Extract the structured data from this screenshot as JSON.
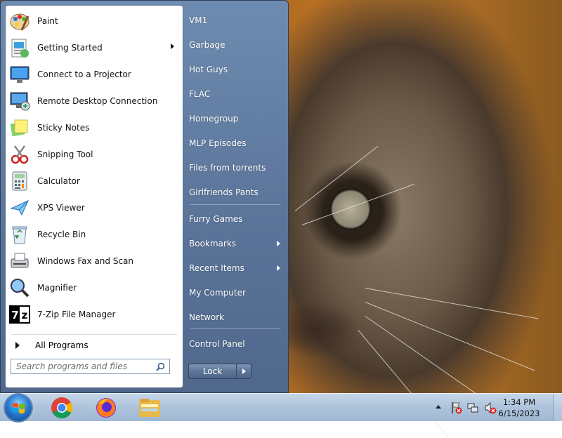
{
  "left_programs": [
    {
      "label": "Paint",
      "icon": "paint-icon",
      "submenu": false
    },
    {
      "label": "Getting Started",
      "icon": "getting-started-icon",
      "submenu": true
    },
    {
      "label": "Connect to a Projector",
      "icon": "projector-icon",
      "submenu": false
    },
    {
      "label": "Remote Desktop Connection",
      "icon": "remote-desktop-icon",
      "submenu": false
    },
    {
      "label": "Sticky Notes",
      "icon": "sticky-notes-icon",
      "submenu": false
    },
    {
      "label": "Snipping Tool",
      "icon": "snipping-tool-icon",
      "submenu": false
    },
    {
      "label": "Calculator",
      "icon": "calculator-icon",
      "submenu": false
    },
    {
      "label": "XPS Viewer",
      "icon": "xps-viewer-icon",
      "submenu": false
    },
    {
      "label": "Recycle Bin",
      "icon": "recycle-bin-icon",
      "submenu": false
    },
    {
      "label": "Windows Fax and Scan",
      "icon": "fax-scan-icon",
      "submenu": false
    },
    {
      "label": "Magnifier",
      "icon": "magnifier-icon",
      "submenu": false
    },
    {
      "label": "7-Zip File Manager",
      "icon": "7zip-icon",
      "submenu": false
    }
  ],
  "all_programs_label": "All Programs",
  "search_placeholder": "Search programs and files",
  "right_links": [
    {
      "label": "VM1",
      "submenu": false
    },
    {
      "label": "Garbage",
      "submenu": false
    },
    {
      "label": "Hot Guys",
      "submenu": false
    },
    {
      "label": "FLAC",
      "submenu": false
    },
    {
      "label": "Homegroup",
      "submenu": false
    },
    {
      "label": "MLP Episodes",
      "submenu": false
    },
    {
      "label": "Files from torrents",
      "submenu": false
    },
    {
      "label": "Girlfriends Pants",
      "submenu": false
    },
    {
      "label": "Furry Games",
      "submenu": false
    },
    {
      "label": "Bookmarks",
      "submenu": true
    },
    {
      "label": "Recent Items",
      "submenu": true
    },
    {
      "label": "My Computer",
      "submenu": false
    },
    {
      "label": "Network",
      "submenu": false
    },
    {
      "label": "Control Panel",
      "submenu": false
    }
  ],
  "power_button_label": "Lock",
  "taskbar_apps": [
    "chrome-icon",
    "firefox-icon",
    "file-explorer-icon"
  ],
  "tray_icons": [
    "show-hidden-icons-arrow",
    "action-center-icon",
    "network-icon",
    "volume-muted-icon"
  ],
  "clock": {
    "time": "1:34 PM",
    "date": "6/15/2023"
  },
  "colors": {
    "menu_right_pane": "#5a7398",
    "taskbar": "#adc3db"
  }
}
